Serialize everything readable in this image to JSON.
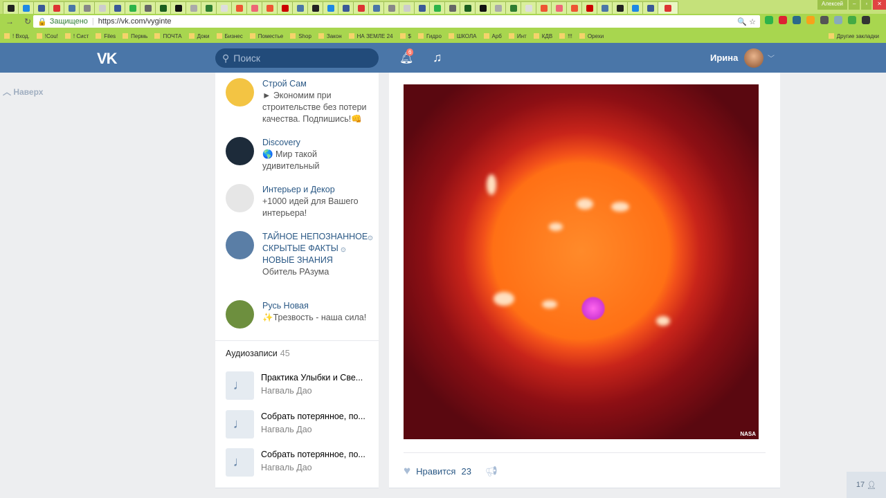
{
  "browser": {
    "tab_count": 44,
    "url_secure_label": "Защищено",
    "url": "https://vk.com/vyginte",
    "profile": "Алексей",
    "bookmarks": [
      "! Вход.",
      "!Cou!",
      "! Сист",
      "Files",
      "Пермь",
      "ПОЧТА",
      "Доки",
      "Бизнес",
      "Поместье",
      "Shop",
      "Закон",
      "НА ЗЕМЛЕ 24",
      "$",
      "Гидро",
      "ШКОЛА",
      "Арб",
      "Инт",
      "КДВ",
      "!!!",
      "Орехи"
    ],
    "other_bookmarks": "Другие закладки"
  },
  "header": {
    "logo": "VK",
    "search_placeholder": "Поиск",
    "notifications": "6",
    "user": "Ирина"
  },
  "back_to_top": "Наверх",
  "groups": [
    {
      "name": "Строй Сам",
      "desc": "► Экономим при строительстве без потери качества. Подпишись!👊",
      "color": "#f3c443"
    },
    {
      "name": "Discovery",
      "desc": "🌎 Мир такой удивительный",
      "color": "#1d2b3a"
    },
    {
      "name": "Интерьер и Декор",
      "desc": "+1000 идей для Вашего интерьера!",
      "color": "#e6e6e6"
    },
    {
      "name": "ТАЙНОЕ НЕПОЗНАННОЕ۞ СКРЫТЫЕ ФАКТЫ ۞ НОВЫЕ ЗНАНИЯ",
      "desc": "Обитель РАзума",
      "color": "#5a7ea6"
    },
    {
      "name": "Русь Новая",
      "desc": "✨Трезвость - наша сила!",
      "color": "#6d8f3e"
    }
  ],
  "audio": {
    "title": "Аудиозаписи",
    "count": "45",
    "tracks": [
      {
        "title": "Практика Улыбки и Све...",
        "artist": "Нагваль Дао"
      },
      {
        "title": "Собрать потерянное, по...",
        "artist": "Нагваль Дао"
      },
      {
        "title": "Собрать потерянное, по...",
        "artist": "Нагваль Дао"
      }
    ]
  },
  "post": {
    "image_credit": "NASA",
    "like_label": "Нравится",
    "likes": "23"
  },
  "online_count": "17"
}
